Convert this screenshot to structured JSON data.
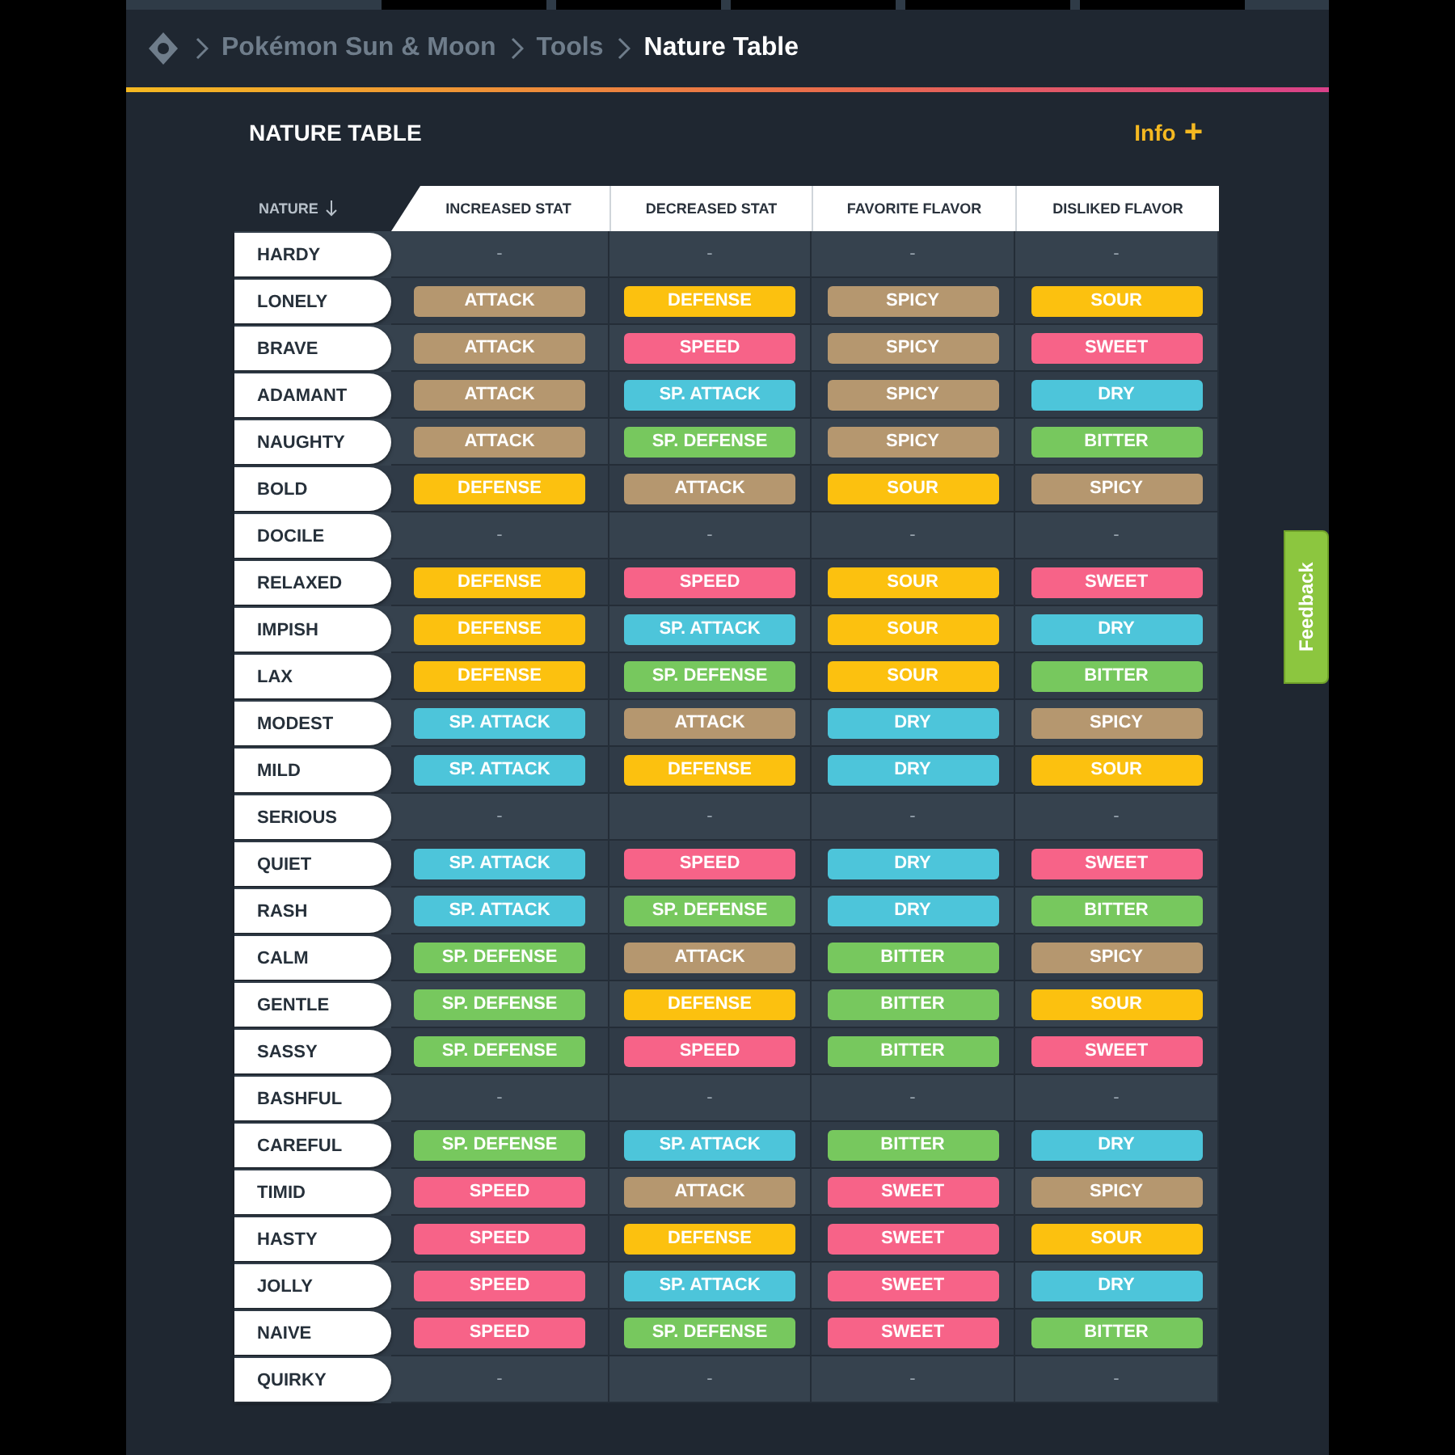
{
  "breadcrumb": {
    "items": [
      "Pokémon Sun & Moon",
      "Tools",
      "Nature Table"
    ]
  },
  "section": {
    "title": "NATURE TABLE",
    "action": "Info",
    "action_icon": "+"
  },
  "table": {
    "columns": [
      {
        "label": "NATURE",
        "sorted": true
      },
      {
        "label": "INCREASED STAT"
      },
      {
        "label": "DECREASED STAT"
      },
      {
        "label": "FAVORITE FLAVOR"
      },
      {
        "label": "DISLIKED FLAVOR"
      }
    ],
    "rows": [
      {
        "cells": [
          {
            "kind": "nature",
            "text": "HARDY"
          },
          {
            "kind": "none",
            "text": "-"
          },
          {
            "kind": "none",
            "text": "-"
          },
          {
            "kind": "none",
            "text": "-"
          },
          {
            "kind": "none",
            "text": "-"
          }
        ]
      },
      {
        "cells": [
          {
            "kind": "nature",
            "text": "LONELY"
          },
          {
            "kind": "tag",
            "text": "ATTACK",
            "color": "#b5976f"
          },
          {
            "kind": "tag",
            "text": "DEFENSE",
            "color": "#fcc10f"
          },
          {
            "kind": "tag",
            "text": "SPICY",
            "color": "#b5976f"
          },
          {
            "kind": "tag",
            "text": "SOUR",
            "color": "#fcc10f"
          }
        ]
      },
      {
        "cells": [
          {
            "kind": "nature",
            "text": "BRAVE"
          },
          {
            "kind": "tag",
            "text": "ATTACK",
            "color": "#b5976f"
          },
          {
            "kind": "tag",
            "text": "SPEED",
            "color": "#f76388"
          },
          {
            "kind": "tag",
            "text": "SPICY",
            "color": "#b5976f"
          },
          {
            "kind": "tag",
            "text": "SWEET",
            "color": "#f76388"
          }
        ]
      },
      {
        "cells": [
          {
            "kind": "nature",
            "text": "ADAMANT"
          },
          {
            "kind": "tag",
            "text": "ATTACK",
            "color": "#b5976f"
          },
          {
            "kind": "tag",
            "text": "SP. ATTACK",
            "color": "#4dc5da"
          },
          {
            "kind": "tag",
            "text": "SPICY",
            "color": "#b5976f"
          },
          {
            "kind": "tag",
            "text": "DRY",
            "color": "#4dc5da"
          }
        ]
      },
      {
        "cells": [
          {
            "kind": "nature",
            "text": "NAUGHTY"
          },
          {
            "kind": "tag",
            "text": "ATTACK",
            "color": "#b5976f"
          },
          {
            "kind": "tag",
            "text": "SP. DEFENSE",
            "color": "#77c85e"
          },
          {
            "kind": "tag",
            "text": "SPICY",
            "color": "#b5976f"
          },
          {
            "kind": "tag",
            "text": "BITTER",
            "color": "#77c85e"
          }
        ]
      },
      {
        "cells": [
          {
            "kind": "nature",
            "text": "BOLD"
          },
          {
            "kind": "tag",
            "text": "DEFENSE",
            "color": "#fcc10f"
          },
          {
            "kind": "tag",
            "text": "ATTACK",
            "color": "#b5976f"
          },
          {
            "kind": "tag",
            "text": "SOUR",
            "color": "#fcc10f"
          },
          {
            "kind": "tag",
            "text": "SPICY",
            "color": "#b5976f"
          }
        ]
      },
      {
        "cells": [
          {
            "kind": "nature",
            "text": "DOCILE"
          },
          {
            "kind": "none",
            "text": "-"
          },
          {
            "kind": "none",
            "text": "-"
          },
          {
            "kind": "none",
            "text": "-"
          },
          {
            "kind": "none",
            "text": "-"
          }
        ]
      },
      {
        "cells": [
          {
            "kind": "nature",
            "text": "RELAXED"
          },
          {
            "kind": "tag",
            "text": "DEFENSE",
            "color": "#fcc10f"
          },
          {
            "kind": "tag",
            "text": "SPEED",
            "color": "#f76388"
          },
          {
            "kind": "tag",
            "text": "SOUR",
            "color": "#fcc10f"
          },
          {
            "kind": "tag",
            "text": "SWEET",
            "color": "#f76388"
          }
        ]
      },
      {
        "cells": [
          {
            "kind": "nature",
            "text": "IMPISH"
          },
          {
            "kind": "tag",
            "text": "DEFENSE",
            "color": "#fcc10f"
          },
          {
            "kind": "tag",
            "text": "SP. ATTACK",
            "color": "#4dc5da"
          },
          {
            "kind": "tag",
            "text": "SOUR",
            "color": "#fcc10f"
          },
          {
            "kind": "tag",
            "text": "DRY",
            "color": "#4dc5da"
          }
        ]
      },
      {
        "cells": [
          {
            "kind": "nature",
            "text": "LAX"
          },
          {
            "kind": "tag",
            "text": "DEFENSE",
            "color": "#fcc10f"
          },
          {
            "kind": "tag",
            "text": "SP. DEFENSE",
            "color": "#77c85e"
          },
          {
            "kind": "tag",
            "text": "SOUR",
            "color": "#fcc10f"
          },
          {
            "kind": "tag",
            "text": "BITTER",
            "color": "#77c85e"
          }
        ]
      },
      {
        "cells": [
          {
            "kind": "nature",
            "text": "MODEST"
          },
          {
            "kind": "tag",
            "text": "SP. ATTACK",
            "color": "#4dc5da"
          },
          {
            "kind": "tag",
            "text": "ATTACK",
            "color": "#b5976f"
          },
          {
            "kind": "tag",
            "text": "DRY",
            "color": "#4dc5da"
          },
          {
            "kind": "tag",
            "text": "SPICY",
            "color": "#b5976f"
          }
        ]
      },
      {
        "cells": [
          {
            "kind": "nature",
            "text": "MILD"
          },
          {
            "kind": "tag",
            "text": "SP. ATTACK",
            "color": "#4dc5da"
          },
          {
            "kind": "tag",
            "text": "DEFENSE",
            "color": "#fcc10f"
          },
          {
            "kind": "tag",
            "text": "DRY",
            "color": "#4dc5da"
          },
          {
            "kind": "tag",
            "text": "SOUR",
            "color": "#fcc10f"
          }
        ]
      },
      {
        "cells": [
          {
            "kind": "nature",
            "text": "SERIOUS"
          },
          {
            "kind": "none",
            "text": "-"
          },
          {
            "kind": "none",
            "text": "-"
          },
          {
            "kind": "none",
            "text": "-"
          },
          {
            "kind": "none",
            "text": "-"
          }
        ]
      },
      {
        "cells": [
          {
            "kind": "nature",
            "text": "QUIET"
          },
          {
            "kind": "tag",
            "text": "SP. ATTACK",
            "color": "#4dc5da"
          },
          {
            "kind": "tag",
            "text": "SPEED",
            "color": "#f76388"
          },
          {
            "kind": "tag",
            "text": "DRY",
            "color": "#4dc5da"
          },
          {
            "kind": "tag",
            "text": "SWEET",
            "color": "#f76388"
          }
        ]
      },
      {
        "cells": [
          {
            "kind": "nature",
            "text": "RASH"
          },
          {
            "kind": "tag",
            "text": "SP. ATTACK",
            "color": "#4dc5da"
          },
          {
            "kind": "tag",
            "text": "SP. DEFENSE",
            "color": "#77c85e"
          },
          {
            "kind": "tag",
            "text": "DRY",
            "color": "#4dc5da"
          },
          {
            "kind": "tag",
            "text": "BITTER",
            "color": "#77c85e"
          }
        ]
      },
      {
        "cells": [
          {
            "kind": "nature",
            "text": "CALM"
          },
          {
            "kind": "tag",
            "text": "SP. DEFENSE",
            "color": "#77c85e"
          },
          {
            "kind": "tag",
            "text": "ATTACK",
            "color": "#b5976f"
          },
          {
            "kind": "tag",
            "text": "BITTER",
            "color": "#77c85e"
          },
          {
            "kind": "tag",
            "text": "SPICY",
            "color": "#b5976f"
          }
        ]
      },
      {
        "cells": [
          {
            "kind": "nature",
            "text": "GENTLE"
          },
          {
            "kind": "tag",
            "text": "SP. DEFENSE",
            "color": "#77c85e"
          },
          {
            "kind": "tag",
            "text": "DEFENSE",
            "color": "#fcc10f"
          },
          {
            "kind": "tag",
            "text": "BITTER",
            "color": "#77c85e"
          },
          {
            "kind": "tag",
            "text": "SOUR",
            "color": "#fcc10f"
          }
        ]
      },
      {
        "cells": [
          {
            "kind": "nature",
            "text": "SASSY"
          },
          {
            "kind": "tag",
            "text": "SP. DEFENSE",
            "color": "#77c85e"
          },
          {
            "kind": "tag",
            "text": "SPEED",
            "color": "#f76388"
          },
          {
            "kind": "tag",
            "text": "BITTER",
            "color": "#77c85e"
          },
          {
            "kind": "tag",
            "text": "SWEET",
            "color": "#f76388"
          }
        ]
      },
      {
        "cells": [
          {
            "kind": "nature",
            "text": "BASHFUL"
          },
          {
            "kind": "none",
            "text": "-"
          },
          {
            "kind": "none",
            "text": "-"
          },
          {
            "kind": "none",
            "text": "-"
          },
          {
            "kind": "none",
            "text": "-"
          }
        ]
      },
      {
        "cells": [
          {
            "kind": "nature",
            "text": "CAREFUL"
          },
          {
            "kind": "tag",
            "text": "SP. DEFENSE",
            "color": "#77c85e"
          },
          {
            "kind": "tag",
            "text": "SP. ATTACK",
            "color": "#4dc5da"
          },
          {
            "kind": "tag",
            "text": "BITTER",
            "color": "#77c85e"
          },
          {
            "kind": "tag",
            "text": "DRY",
            "color": "#4dc5da"
          }
        ]
      },
      {
        "cells": [
          {
            "kind": "nature",
            "text": "TIMID"
          },
          {
            "kind": "tag",
            "text": "SPEED",
            "color": "#f76388"
          },
          {
            "kind": "tag",
            "text": "ATTACK",
            "color": "#b5976f"
          },
          {
            "kind": "tag",
            "text": "SWEET",
            "color": "#f76388"
          },
          {
            "kind": "tag",
            "text": "SPICY",
            "color": "#b5976f"
          }
        ]
      },
      {
        "cells": [
          {
            "kind": "nature",
            "text": "HASTY"
          },
          {
            "kind": "tag",
            "text": "SPEED",
            "color": "#f76388"
          },
          {
            "kind": "tag",
            "text": "DEFENSE",
            "color": "#fcc10f"
          },
          {
            "kind": "tag",
            "text": "SWEET",
            "color": "#f76388"
          },
          {
            "kind": "tag",
            "text": "SOUR",
            "color": "#fcc10f"
          }
        ]
      },
      {
        "cells": [
          {
            "kind": "nature",
            "text": "JOLLY"
          },
          {
            "kind": "tag",
            "text": "SPEED",
            "color": "#f76388"
          },
          {
            "kind": "tag",
            "text": "SP. ATTACK",
            "color": "#4dc5da"
          },
          {
            "kind": "tag",
            "text": "SWEET",
            "color": "#f76388"
          },
          {
            "kind": "tag",
            "text": "DRY",
            "color": "#4dc5da"
          }
        ]
      },
      {
        "cells": [
          {
            "kind": "nature",
            "text": "NAIVE"
          },
          {
            "kind": "tag",
            "text": "SPEED",
            "color": "#f76388"
          },
          {
            "kind": "tag",
            "text": "SP. DEFENSE",
            "color": "#77c85e"
          },
          {
            "kind": "tag",
            "text": "SWEET",
            "color": "#f76388"
          },
          {
            "kind": "tag",
            "text": "BITTER",
            "color": "#77c85e"
          }
        ]
      },
      {
        "cells": [
          {
            "kind": "nature",
            "text": "QUIRKY"
          },
          {
            "kind": "none",
            "text": "-"
          },
          {
            "kind": "none",
            "text": "-"
          },
          {
            "kind": "none",
            "text": "-"
          },
          {
            "kind": "none",
            "text": "-"
          }
        ]
      }
    ]
  },
  "feedback": {
    "label": "Feedback"
  }
}
